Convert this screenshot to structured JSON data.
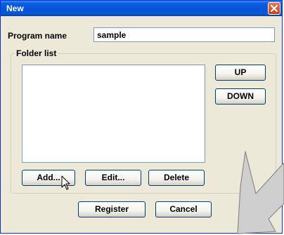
{
  "window": {
    "title": "New"
  },
  "form": {
    "program_name_label": "Program name",
    "program_name_value": "sample",
    "folder_list_label": "Folder list"
  },
  "buttons": {
    "up": "UP",
    "down": "DOWN",
    "add": "Add...",
    "edit": "Edit...",
    "delete": "Delete",
    "register": "Register",
    "cancel": "Cancel"
  },
  "colors": {
    "titlebar": "#0554d8",
    "window_bg": "#ece9d8",
    "close_button": "#c63f1a",
    "button_border": "#003c74",
    "callout_arrow": "#c8c8c8"
  },
  "icons": [
    "close-icon",
    "mouse-cursor-icon",
    "callout-arrow-icon"
  ]
}
